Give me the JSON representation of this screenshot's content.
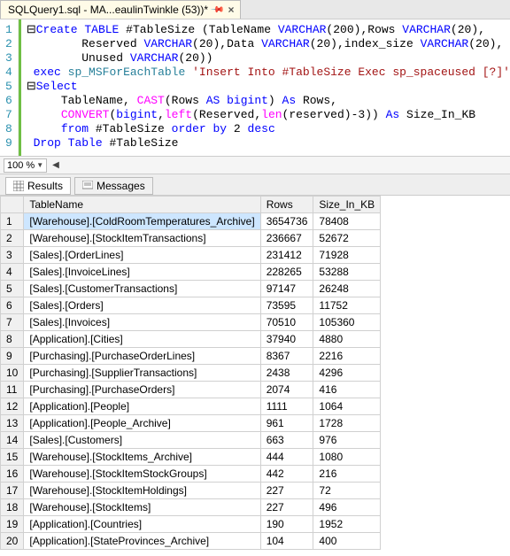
{
  "tab": {
    "title": "SQLQuery1.sql - MA...eaulinTwinkle (53))*"
  },
  "editor": {
    "lines": [
      1,
      2,
      3,
      4,
      5,
      6,
      7,
      8,
      9
    ],
    "code": [
      [
        {
          "t": "⊟",
          "c": ""
        },
        {
          "t": "Create",
          "c": "kw"
        },
        {
          "t": " ",
          "c": ""
        },
        {
          "t": "TABLE",
          "c": "kw"
        },
        {
          "t": " #TableSize ",
          "c": ""
        },
        {
          "t": "(",
          "c": ""
        },
        {
          "t": "TableName ",
          "c": ""
        },
        {
          "t": "VARCHAR",
          "c": "kw"
        },
        {
          "t": "(",
          "c": ""
        },
        {
          "t": "200",
          "c": "num"
        },
        {
          "t": ")",
          "c": ""
        },
        {
          "t": ",",
          "c": ""
        },
        {
          "t": "Rows ",
          "c": ""
        },
        {
          "t": "VARCHAR",
          "c": "kw"
        },
        {
          "t": "(",
          "c": ""
        },
        {
          "t": "20",
          "c": "num"
        },
        {
          "t": ")",
          "c": ""
        },
        {
          "t": ",",
          "c": ""
        }
      ],
      [
        {
          "t": "        Reserved ",
          "c": ""
        },
        {
          "t": "VARCHAR",
          "c": "kw"
        },
        {
          "t": "(",
          "c": ""
        },
        {
          "t": "20",
          "c": "num"
        },
        {
          "t": ")",
          "c": ""
        },
        {
          "t": ",",
          "c": ""
        },
        {
          "t": "Data ",
          "c": ""
        },
        {
          "t": "VARCHAR",
          "c": "kw"
        },
        {
          "t": "(",
          "c": ""
        },
        {
          "t": "20",
          "c": "num"
        },
        {
          "t": ")",
          "c": ""
        },
        {
          "t": ",",
          "c": ""
        },
        {
          "t": "index_size ",
          "c": ""
        },
        {
          "t": "VARCHAR",
          "c": "kw"
        },
        {
          "t": "(",
          "c": ""
        },
        {
          "t": "20",
          "c": "num"
        },
        {
          "t": ")",
          "c": ""
        },
        {
          "t": ",",
          "c": ""
        }
      ],
      [
        {
          "t": "        Unused ",
          "c": ""
        },
        {
          "t": "VARCHAR",
          "c": "kw"
        },
        {
          "t": "(",
          "c": ""
        },
        {
          "t": "20",
          "c": "num"
        },
        {
          "t": "))",
          "c": ""
        }
      ],
      [
        {
          "t": " ",
          "c": ""
        },
        {
          "t": "exec",
          "c": "kw"
        },
        {
          "t": " ",
          "c": ""
        },
        {
          "t": "sp_MSForEachTable",
          "c": "sys"
        },
        {
          "t": " ",
          "c": ""
        },
        {
          "t": "'Insert Into #TableSize Exec sp_spaceused [?]'",
          "c": "str"
        }
      ],
      [
        {
          "t": "⊟",
          "c": ""
        },
        {
          "t": "Select",
          "c": "kw"
        }
      ],
      [
        {
          "t": "     TableName",
          "c": ""
        },
        {
          "t": ", ",
          "c": ""
        },
        {
          "t": "CAST",
          "c": "fn"
        },
        {
          "t": "(",
          "c": ""
        },
        {
          "t": "Rows ",
          "c": ""
        },
        {
          "t": "AS",
          "c": "kw"
        },
        {
          "t": " ",
          "c": ""
        },
        {
          "t": "bigint",
          "c": "kw"
        },
        {
          "t": ")",
          "c": ""
        },
        {
          "t": " ",
          "c": ""
        },
        {
          "t": "As",
          "c": "kw"
        },
        {
          "t": " Rows",
          "c": ""
        },
        {
          "t": ",",
          "c": ""
        }
      ],
      [
        {
          "t": "     ",
          "c": ""
        },
        {
          "t": "CONVERT",
          "c": "fn"
        },
        {
          "t": "(",
          "c": ""
        },
        {
          "t": "bigint",
          "c": "kw"
        },
        {
          "t": ",",
          "c": ""
        },
        {
          "t": "left",
          "c": "fn"
        },
        {
          "t": "(",
          "c": ""
        },
        {
          "t": "Reserved",
          "c": ""
        },
        {
          "t": ",",
          "c": ""
        },
        {
          "t": "len",
          "c": "fn"
        },
        {
          "t": "(",
          "c": ""
        },
        {
          "t": "reserved",
          "c": ""
        },
        {
          "t": ")-",
          "c": ""
        },
        {
          "t": "3",
          "c": "num"
        },
        {
          "t": "))",
          "c": ""
        },
        {
          "t": " ",
          "c": ""
        },
        {
          "t": "As",
          "c": "kw"
        },
        {
          "t": " Size_In_KB",
          "c": ""
        }
      ],
      [
        {
          "t": "     ",
          "c": ""
        },
        {
          "t": "from",
          "c": "kw"
        },
        {
          "t": " #TableSize ",
          "c": ""
        },
        {
          "t": "order",
          "c": "kw"
        },
        {
          "t": " ",
          "c": ""
        },
        {
          "t": "by",
          "c": "kw"
        },
        {
          "t": " ",
          "c": ""
        },
        {
          "t": "2",
          "c": "num"
        },
        {
          "t": " ",
          "c": ""
        },
        {
          "t": "desc",
          "c": "kw"
        }
      ],
      [
        {
          "t": " ",
          "c": ""
        },
        {
          "t": "Drop",
          "c": "kw"
        },
        {
          "t": " ",
          "c": ""
        },
        {
          "t": "Table",
          "c": "kw"
        },
        {
          "t": " #TableSize",
          "c": ""
        }
      ]
    ]
  },
  "zoom": {
    "value": "100 %"
  },
  "resultTabs": {
    "results": "Results",
    "messages": "Messages"
  },
  "grid": {
    "columns": [
      "TableName",
      "Rows",
      "Size_In_KB"
    ],
    "rows": [
      {
        "n": "1",
        "name": "[Warehouse].[ColdRoomTemperatures_Archive]",
        "rows": "3654736",
        "kb": "78408",
        "sel": true
      },
      {
        "n": "2",
        "name": "[Warehouse].[StockItemTransactions]",
        "rows": "236667",
        "kb": "52672"
      },
      {
        "n": "3",
        "name": "[Sales].[OrderLines]",
        "rows": "231412",
        "kb": "71928"
      },
      {
        "n": "4",
        "name": "[Sales].[InvoiceLines]",
        "rows": "228265",
        "kb": "53288"
      },
      {
        "n": "5",
        "name": "[Sales].[CustomerTransactions]",
        "rows": "97147",
        "kb": "26248"
      },
      {
        "n": "6",
        "name": "[Sales].[Orders]",
        "rows": "73595",
        "kb": "11752"
      },
      {
        "n": "7",
        "name": "[Sales].[Invoices]",
        "rows": "70510",
        "kb": "105360"
      },
      {
        "n": "8",
        "name": "[Application].[Cities]",
        "rows": "37940",
        "kb": "4880"
      },
      {
        "n": "9",
        "name": "[Purchasing].[PurchaseOrderLines]",
        "rows": "8367",
        "kb": "2216"
      },
      {
        "n": "10",
        "name": "[Purchasing].[SupplierTransactions]",
        "rows": "2438",
        "kb": "4296"
      },
      {
        "n": "11",
        "name": "[Purchasing].[PurchaseOrders]",
        "rows": "2074",
        "kb": "416"
      },
      {
        "n": "12",
        "name": "[Application].[People]",
        "rows": "1111",
        "kb": "1064"
      },
      {
        "n": "13",
        "name": "[Application].[People_Archive]",
        "rows": "961",
        "kb": "1728"
      },
      {
        "n": "14",
        "name": "[Sales].[Customers]",
        "rows": "663",
        "kb": "976"
      },
      {
        "n": "15",
        "name": "[Warehouse].[StockItems_Archive]",
        "rows": "444",
        "kb": "1080"
      },
      {
        "n": "16",
        "name": "[Warehouse].[StockItemStockGroups]",
        "rows": "442",
        "kb": "216"
      },
      {
        "n": "17",
        "name": "[Warehouse].[StockItemHoldings]",
        "rows": "227",
        "kb": "72"
      },
      {
        "n": "18",
        "name": "[Warehouse].[StockItems]",
        "rows": "227",
        "kb": "496"
      },
      {
        "n": "19",
        "name": "[Application].[Countries]",
        "rows": "190",
        "kb": "1952"
      },
      {
        "n": "20",
        "name": "[Application].[StateProvinces_Archive]",
        "rows": "104",
        "kb": "400"
      }
    ]
  }
}
